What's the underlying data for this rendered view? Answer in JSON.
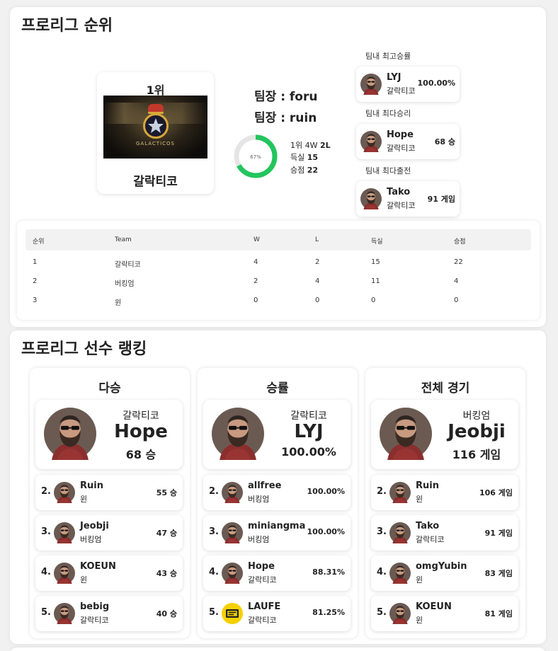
{
  "league": {
    "title": "프로리그 순위",
    "leader": {
      "place": "1위",
      "team_name": "갈락티코",
      "logo_text": "GALACTICOS",
      "captain_lines": [
        "팀장 : foru",
        "팀장 : ruin"
      ],
      "win_rate_label": "67%",
      "win_rate": 0.67,
      "record_prefix": "1위 4W ",
      "record_losses": "2L",
      "goal_diff_label": "득실 ",
      "goal_diff": "15",
      "points_label": "승점 ",
      "points": "22"
    },
    "team_best": [
      {
        "label": "팀내 최고승률",
        "name": "LYJ",
        "team": "갈락티코",
        "value": "100.00%"
      },
      {
        "label": "팀내 최다승리",
        "name": "Hope",
        "team": "갈락티코",
        "value": "68 승"
      },
      {
        "label": "팀내 최다출전",
        "name": "Tako",
        "team": "갈락티코",
        "value": "91 게임"
      }
    ],
    "table": {
      "headers": [
        "순위",
        "Team",
        "W",
        "L",
        "득실",
        "승점"
      ],
      "rows": [
        [
          "1",
          "갈락티코",
          "4",
          "2",
          "15",
          "22"
        ],
        [
          "2",
          "버킹엄",
          "2",
          "4",
          "11",
          "4"
        ],
        [
          "3",
          "윈",
          "0",
          "0",
          "0",
          "0"
        ]
      ]
    }
  },
  "players": {
    "title": "프로리그 선수 랭킹",
    "columns": [
      {
        "title": "다승",
        "top": {
          "team": "갈락티코",
          "name": "Hope",
          "value": "68 승"
        },
        "rows": [
          {
            "rank": "2.",
            "name": "Ruin",
            "team": "윈",
            "value": "55 승"
          },
          {
            "rank": "3.",
            "name": "Jeobji",
            "team": "버킹엄",
            "value": "47 승"
          },
          {
            "rank": "4.",
            "name": "KOEUN",
            "team": "윈",
            "value": "43 승"
          },
          {
            "rank": "5.",
            "name": "bebig",
            "team": "갈락티코",
            "value": "40 승"
          }
        ]
      },
      {
        "title": "승률",
        "top": {
          "team": "갈락티코",
          "name": "LYJ",
          "value": "100.00%"
        },
        "rows": [
          {
            "rank": "2.",
            "name": "allfree",
            "team": "버킹엄",
            "value": "100.00%"
          },
          {
            "rank": "3.",
            "name": "miniangma",
            "team": "버킹엄",
            "value": "100.00%"
          },
          {
            "rank": "4.",
            "name": "Hope",
            "team": "갈락티코",
            "value": "88.31%"
          },
          {
            "rank": "5.",
            "name": "LAUFE",
            "team": "갈락티코",
            "value": "81.25%"
          }
        ]
      },
      {
        "title": "전체 경기",
        "top": {
          "team": "버킹엄",
          "name": "Jeobji",
          "value": "116 게임"
        },
        "rows": [
          {
            "rank": "2.",
            "name": "Ruin",
            "team": "윈",
            "value": "106 게임"
          },
          {
            "rank": "3.",
            "name": "Tako",
            "team": "갈락티코",
            "value": "91 게임"
          },
          {
            "rank": "4.",
            "name": "omgYubin",
            "team": "윈",
            "value": "83 게임"
          },
          {
            "rank": "5.",
            "name": "KOEUN",
            "team": "윈",
            "value": "81 게임"
          }
        ]
      }
    ]
  },
  "colors": {
    "donut_fill": "#22c55e",
    "donut_track": "#e5e5e5",
    "avatar_badge_yellow": "#f5d000"
  },
  "icons": {
    "player_avatar": "bearded-man-avatar-icon",
    "badge_avatar": "yellow-badge-avatar-icon"
  }
}
